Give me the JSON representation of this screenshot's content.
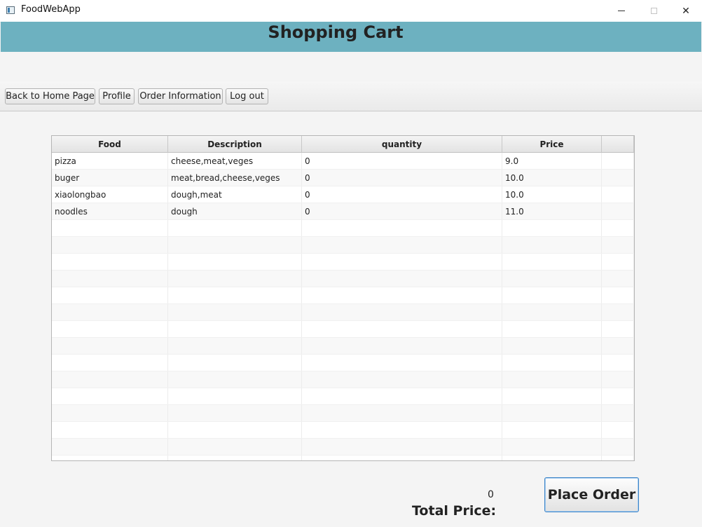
{
  "window": {
    "title": "FoodWebApp",
    "controls": {
      "minimize": "minimize",
      "maximize": "maximize",
      "close": "✕"
    }
  },
  "header": {
    "title": "Shopping Cart"
  },
  "toolbar": {
    "home_label": "Back to Home Page",
    "profile_label": "Profile",
    "order_label": "Order Information",
    "logout_label": "Log out"
  },
  "table": {
    "columns": [
      "Food",
      "Description",
      "quantity",
      "Price",
      ""
    ],
    "rows": [
      {
        "food": "pizza",
        "description": "cheese,meat,veges",
        "quantity": "0",
        "price": "9.0"
      },
      {
        "food": "buger",
        "description": "meat,bread,cheese,veges",
        "quantity": "0",
        "price": "10.0"
      },
      {
        "food": "xiaolongbao",
        "description": "dough,meat",
        "quantity": "0",
        "price": "10.0"
      },
      {
        "food": "noodles",
        "description": "dough",
        "quantity": "0",
        "price": "11.0"
      }
    ],
    "empty_rows": 15
  },
  "footer": {
    "total_value": "0",
    "total_label": "Total Price:",
    "place_order_label": "Place Order"
  },
  "colors": {
    "header_band": "#6db1c0",
    "focus_border": "#3f86c8"
  }
}
